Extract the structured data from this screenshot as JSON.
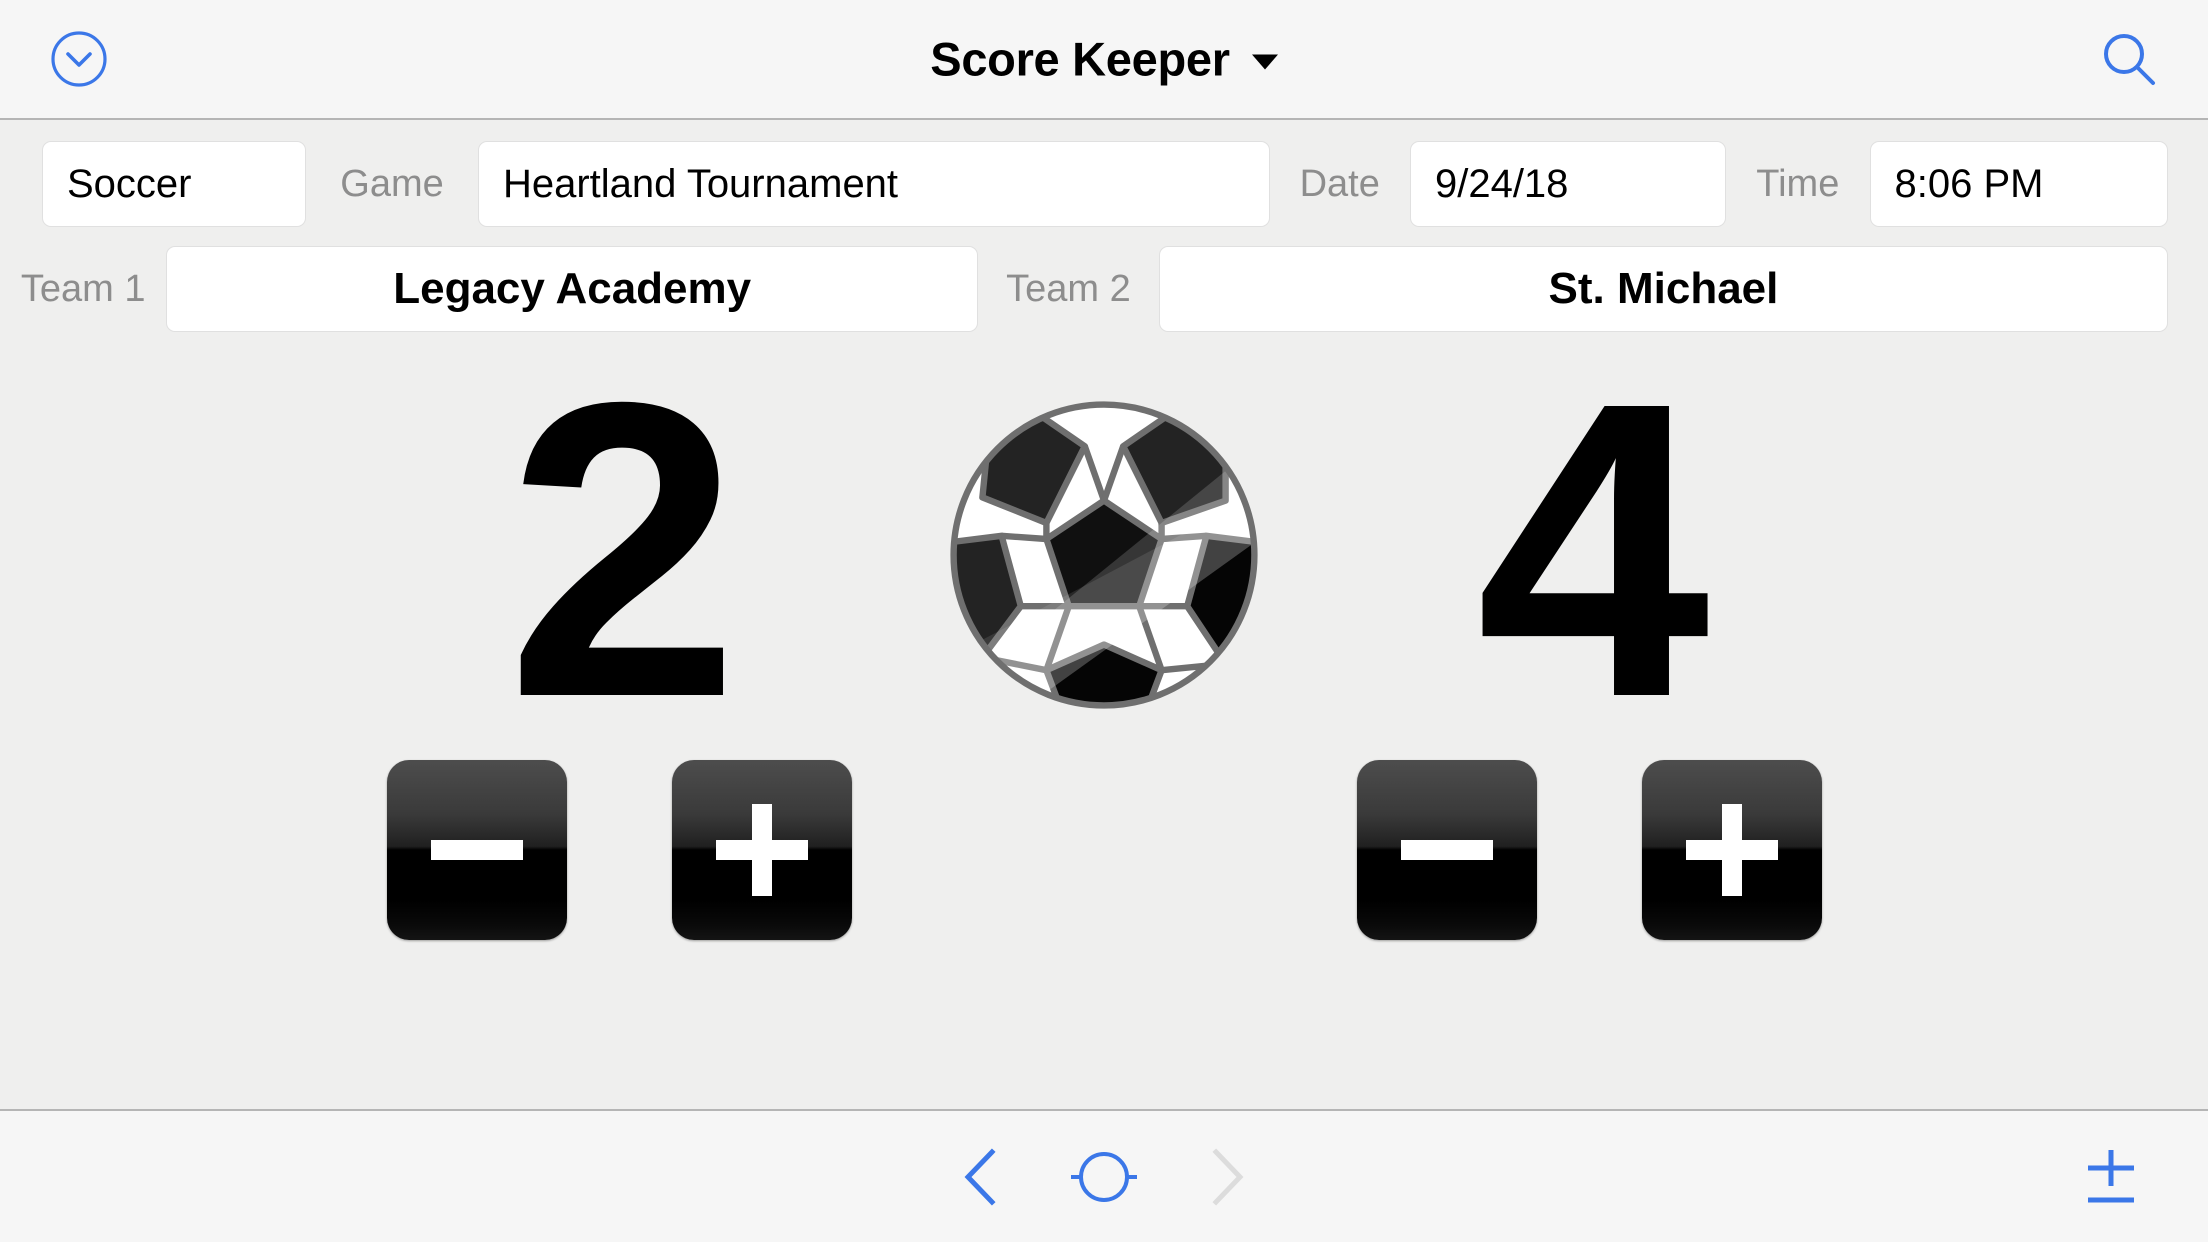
{
  "header": {
    "title": "Score Keeper",
    "back_icon": "chevron-down-circle-icon",
    "caret_icon": "triangle-down-icon",
    "search_icon": "search-icon"
  },
  "form": {
    "sport": {
      "label_icon": "",
      "value": "Soccer"
    },
    "game": {
      "label": "Game",
      "value": "Heartland Tournament"
    },
    "date": {
      "label": "Date",
      "value": "9/24/18"
    },
    "time": {
      "label": "Time",
      "value": "8:06 PM"
    },
    "team1": {
      "label": "Team 1",
      "value": "Legacy Academy"
    },
    "team2": {
      "label": "Team 2",
      "value": "St. Michael"
    }
  },
  "scoreboard": {
    "sport_icon": "soccer-ball-icon",
    "team1_score": "2",
    "team2_score": "4",
    "decrement_icon": "minus-icon",
    "increment_icon": "plus-icon"
  },
  "toolbar": {
    "previous_icon": "chevron-left-icon",
    "record_icon": "record-circle-icon",
    "next_icon": "chevron-right-icon",
    "add_icon": "add-record-icon"
  },
  "colors": {
    "accent": "#3b77e8",
    "accent_disabled": "#dcdcdc",
    "page_background": "#efefee",
    "bar_background": "#f6f6f6",
    "label_text": "#8d8d8d",
    "field_background": "#ffffff",
    "field_border": "#e0e0e0",
    "button_dark": "#000000"
  }
}
